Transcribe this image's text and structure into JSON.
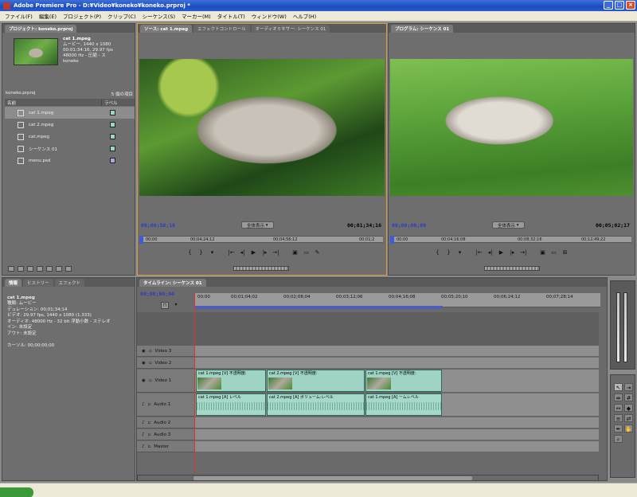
{
  "window": {
    "title": "Adobe Premiere Pro - D:¥Video¥koneko¥koneko.prproj *",
    "controls": [
      "_",
      "□",
      "×"
    ]
  },
  "menu": [
    "ファイル(F)",
    "編集(E)",
    "プロジェクト(P)",
    "クリップ(C)",
    "シーケンス(S)",
    "マーカー(M)",
    "タイトル(T)",
    "ウィンドウ(W)",
    "ヘルプ(H)"
  ],
  "project": {
    "tab": "プロジェクト: koneko.prproj",
    "clip_name": "cat 1.mpeg",
    "clip_info": [
      "ムービー, 1440 x 1080",
      "00:01:34:16, 29.97 fps",
      "48000 Hz - 圧縮 - ス",
      "koneko"
    ],
    "bin_name": "koneko.prproj",
    "item_count": "5 個の項目",
    "col_name": "名前",
    "col_label": "ラベル",
    "items": [
      {
        "name": "cat 1.mpeg",
        "label_color": "#9fd3c4",
        "selected": true
      },
      {
        "name": "cat 2.mpeg",
        "label_color": "#9fd3c4",
        "selected": false
      },
      {
        "name": "cat.mpeg",
        "label_color": "#9fd3c4",
        "selected": false
      },
      {
        "name": "シーケンス 01",
        "label_color": "#9fd3c4",
        "selected": false
      },
      {
        "name": "menu.psd",
        "label_color": "#b0a7d8",
        "selected": false
      }
    ]
  },
  "source_monitor": {
    "tabs": [
      "ソース: cat 1.mpeg",
      "エフェクトコントロール",
      "オーディオミキサー: シーケンス 01"
    ],
    "timecode_left": "00;00;56;16",
    "timecode_right": "00;01;34;16",
    "fit_label": "全体表示",
    "ruler": [
      "00;00",
      "00;04;24;12",
      "00;04;56;12",
      "00;01;2"
    ]
  },
  "program_monitor": {
    "tab": "プログラム: シーケンス 01",
    "timecode_left": "00;00;00;00",
    "timecode_right": "00;05;02;17",
    "fit_label": "全体表示",
    "ruler": [
      "00;00",
      "00;04;16;08",
      "00;08;32;16",
      "00;12;49;22"
    ]
  },
  "info_panel": {
    "tabs": [
      "情報",
      "ヒストリー",
      "エフェクト"
    ],
    "lines": [
      "cat 1.mpeg",
      "種類: ムービー",
      "デュレーション: 00;01;34;14",
      "ビデオ: 29.97 fps, 1440 x 1080 (1.333)",
      "オーディオ: 48000 Hz - 32 bit 浮動小数 - ステレオ",
      "イン: 未設定",
      "アウト: 未設定",
      "カーソル: 00;00;00;00"
    ]
  },
  "timeline": {
    "tab": "タイムライン: シーケンス 01",
    "current_timecode": "00;00;00;00",
    "ruler": [
      "00;00",
      "00;01;04;02",
      "00;02;08;04",
      "00;03;12;06",
      "00;04;16;08",
      "00;05;20;10",
      "00;06;24;12",
      "00;07;28;14"
    ],
    "tracks": [
      {
        "name": "Video 3",
        "kind": "video"
      },
      {
        "name": "Video 2",
        "kind": "video"
      },
      {
        "name": "Video 1",
        "kind": "video"
      },
      {
        "name": "Audio 1",
        "kind": "audio"
      },
      {
        "name": "Audio 2",
        "kind": "audio"
      },
      {
        "name": "Audio 3",
        "kind": "audio"
      },
      {
        "name": "Master",
        "kind": "audio"
      }
    ],
    "video_clips": [
      "cat 1.mpeg [V] 不透明度:",
      "cat 2.mpeg [V] 不透明度:",
      "cat 1.mpeg [V] 不透明度:"
    ],
    "audio_clips": [
      "cat 1.mpeg [A] レベル",
      "cat 2.mpeg [A] ボリューム:レベル",
      "cat 1.mpeg [A] ームレベル"
    ]
  }
}
